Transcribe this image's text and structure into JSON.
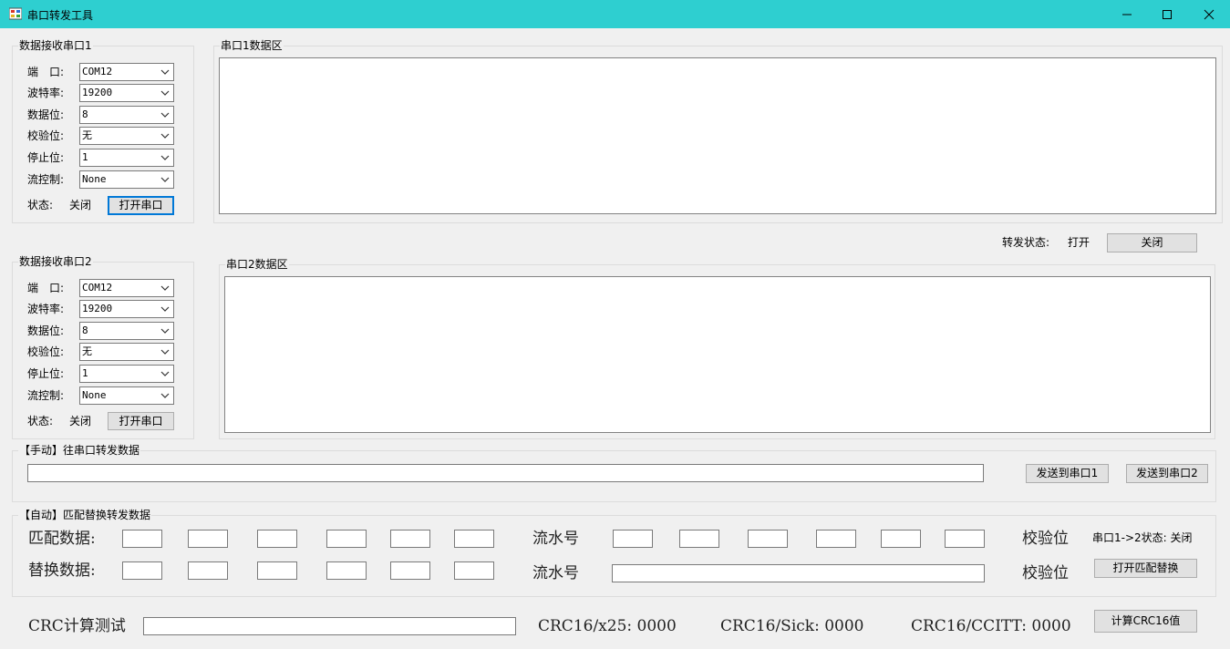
{
  "window": {
    "title": "串口转发工具",
    "minimize": "—",
    "maximize": "☐",
    "close": "✕"
  },
  "port1": {
    "group_title": "数据接收串口1",
    "labels": {
      "port": "端　口:",
      "baud": "波特率:",
      "databits": "数据位:",
      "parity": "校验位:",
      "stopbits": "停止位:",
      "flow": "流控制:",
      "status": "状态:"
    },
    "values": {
      "port": "COM12",
      "baud": "19200",
      "databits": "8",
      "parity": "无",
      "stopbits": "1",
      "flow": "None"
    },
    "status_value": "关闭",
    "open_button": "打开串口",
    "data_area_title": "串口1数据区"
  },
  "forward": {
    "status_label": "转发状态:",
    "status_value": "打开",
    "close_button": "关闭"
  },
  "port2": {
    "group_title": "数据接收串口2",
    "labels": {
      "port": "端　口:",
      "baud": "波特率:",
      "databits": "数据位:",
      "parity": "校验位:",
      "stopbits": "停止位:",
      "flow": "流控制:",
      "status": "状态:"
    },
    "values": {
      "port": "COM12",
      "baud": "19200",
      "databits": "8",
      "parity": "无",
      "stopbits": "1",
      "flow": "None"
    },
    "status_value": "关闭",
    "open_button": "打开串口",
    "data_area_title": "串口2数据区"
  },
  "manual": {
    "group_title": "【手动】往串口转发数据",
    "input_value": "",
    "send1_button": "发送到串口1",
    "send2_button": "发送到串口2"
  },
  "auto": {
    "group_title": "【自动】匹配替换转发数据",
    "match_label": "匹配数据:",
    "replace_label": "替换数据:",
    "serial_label": "流水号",
    "checksum_label": "校验位",
    "status_text": "串口1->2状态: 关闭",
    "open_replace_button": "打开匹配替换"
  },
  "crc": {
    "label": "CRC计算测试",
    "input_value": "",
    "x25": "CRC16/x25: 0000",
    "sick": "CRC16/Sick: 0000",
    "ccitt": "CRC16/CCITT: 0000",
    "compute_button": "计算CRC16值"
  }
}
